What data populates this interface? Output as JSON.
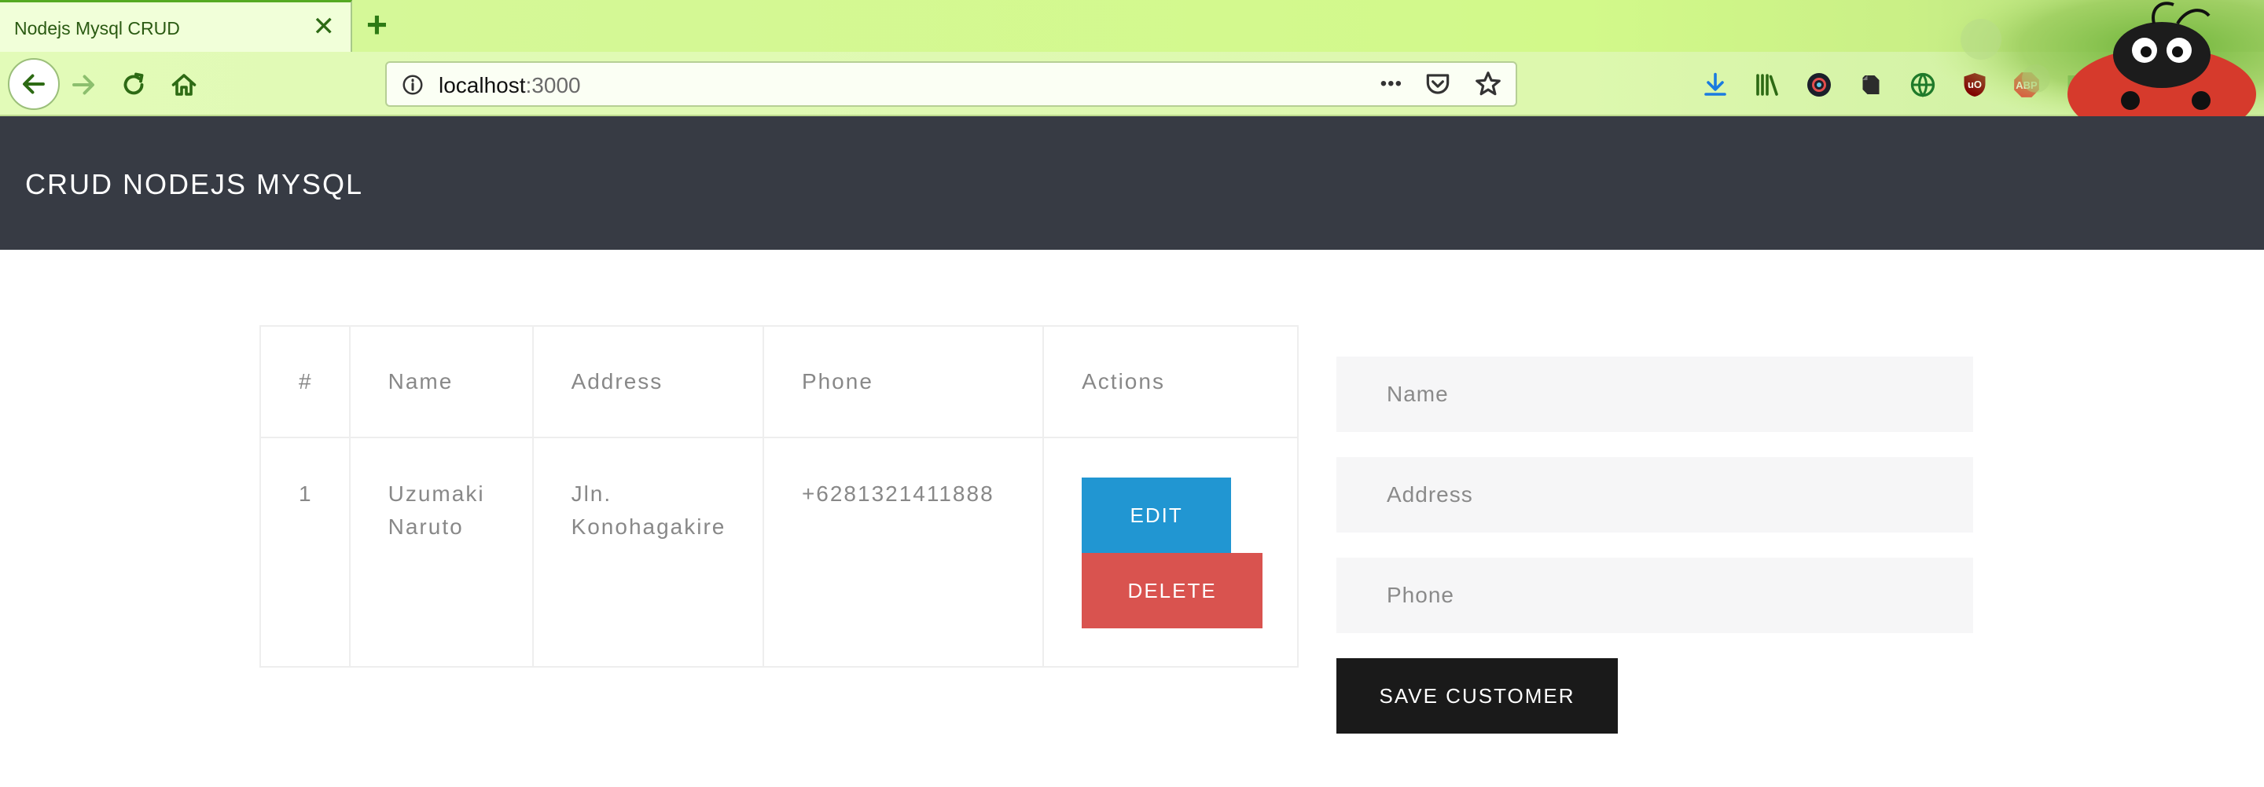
{
  "browser": {
    "tab_title": "Nodejs Mysql CRUD",
    "tab_close_glyph": "✕",
    "new_tab_glyph": "+",
    "url_host": "localhost",
    "url_port": ":3000",
    "url_more_glyph": "•••",
    "theme_colors": {
      "tabbar": "#d2f98a",
      "navbar": "#e2fbb8",
      "accent": "#2d7a14"
    },
    "icons": [
      "back-icon",
      "forward-icon",
      "reload-icon",
      "home-icon",
      "info-icon",
      "page-actions-icon",
      "pocket-icon",
      "bookmark-star-icon",
      "download-icon",
      "library-icon",
      "extension-dark-circle-icon",
      "evernote-icon",
      "extension-globe-icon",
      "ublock-icon",
      "adblock-plus-icon",
      "extension-window-icon",
      "save-icon",
      "duckduckgo-icon",
      "menu-icon"
    ],
    "abp_label": "ABP",
    "ublock_label": "uO"
  },
  "header": {
    "title": "CRUD NODEJS MYSQL",
    "background": "#373b44"
  },
  "table": {
    "headers": [
      "#",
      "Name",
      "Address",
      "Phone",
      "Actions"
    ],
    "rows": [
      {
        "num": "1",
        "name": "Uzumaki Naruto",
        "address": "Jln. Konohagakire",
        "phone": "+6281321411888"
      }
    ],
    "edit_label": "EDIT",
    "delete_label": "DELETE",
    "edit_color": "#2196d2",
    "delete_color": "#d9534f"
  },
  "form": {
    "name_placeholder": "Name",
    "address_placeholder": "Address",
    "phone_placeholder": "Phone",
    "name_value": "",
    "address_value": "",
    "phone_value": "",
    "save_label": "SAVE CUSTOMER",
    "save_color": "#1a1a1a"
  }
}
